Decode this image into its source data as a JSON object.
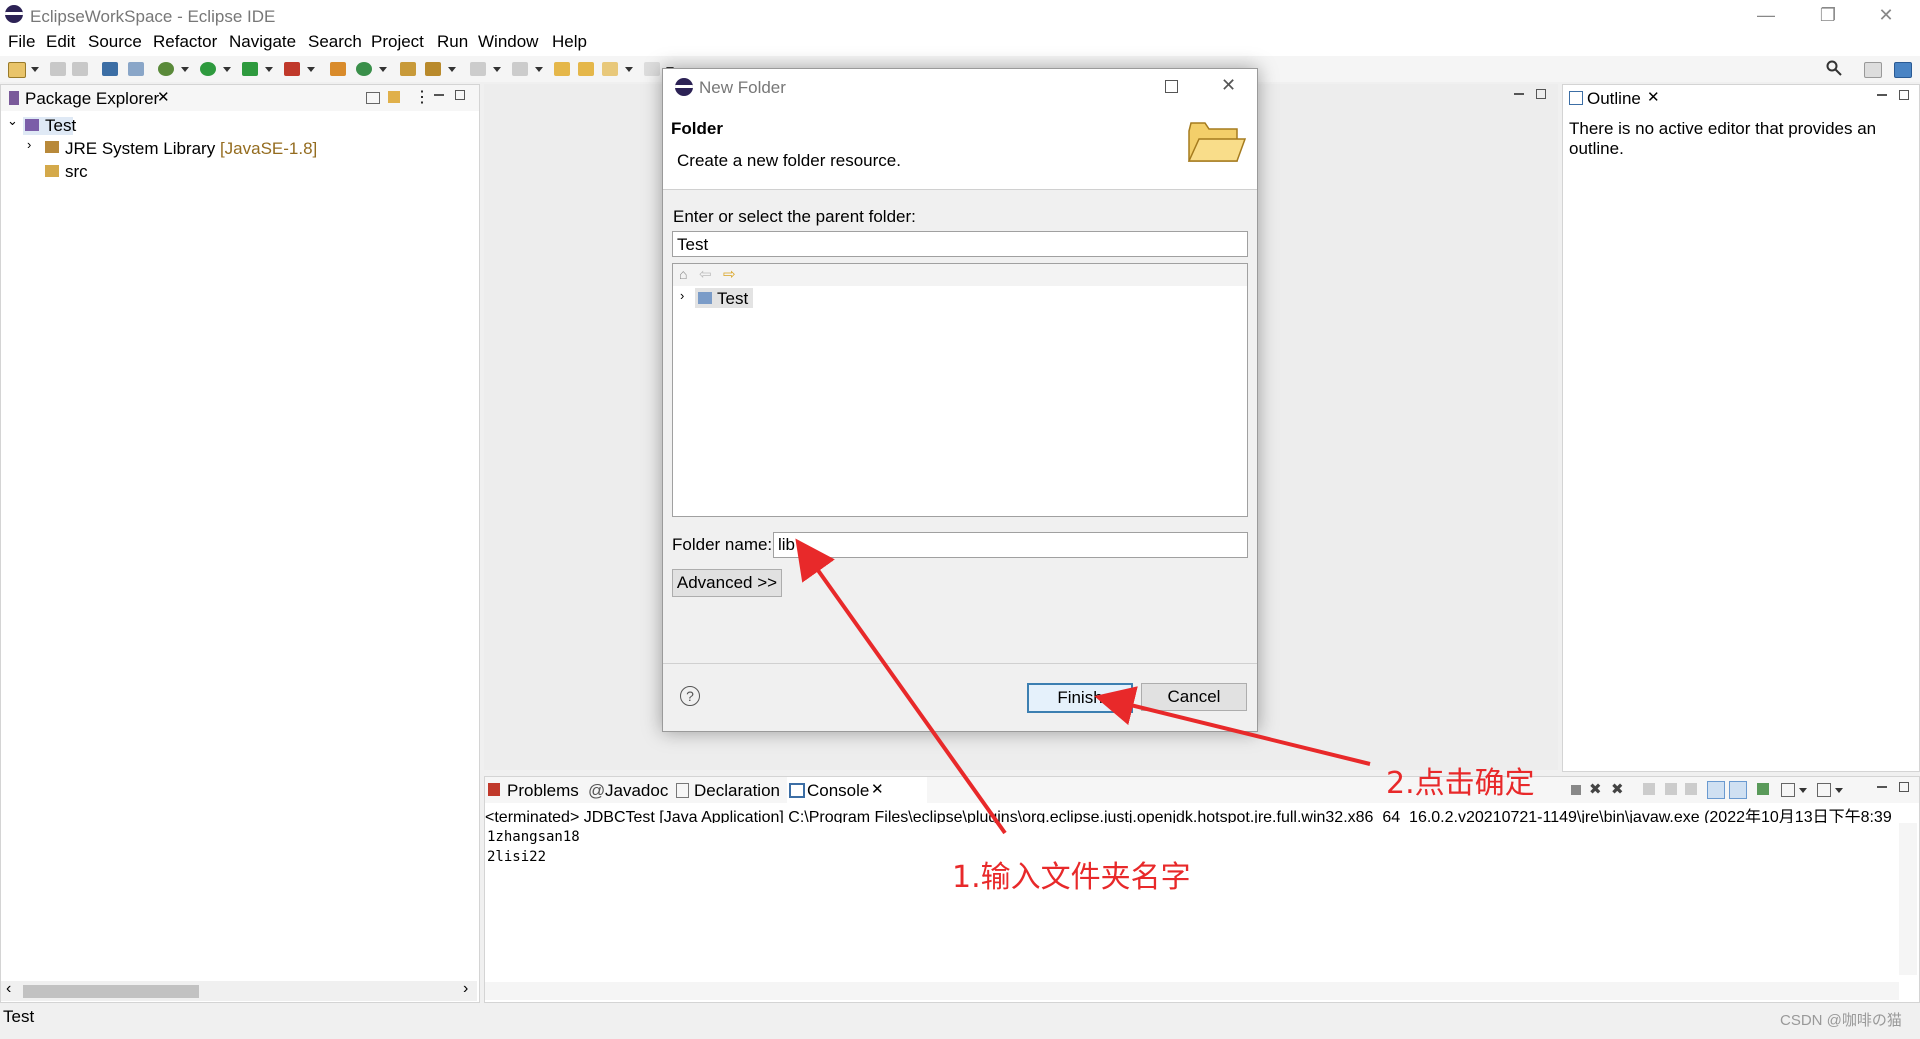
{
  "window": {
    "title": "EclipseWorkSpace - Eclipse IDE",
    "controls": {
      "minimize": "—",
      "restore": "❐",
      "close": "✕"
    }
  },
  "menu": [
    "File",
    "Edit",
    "Source",
    "Refactor",
    "Navigate",
    "Search",
    "Project",
    "Run",
    "Window",
    "Help"
  ],
  "package_explorer": {
    "tab": "Package Explorer",
    "tree": [
      {
        "label": "Test",
        "expanded": true
      },
      {
        "label": "JRE System Library",
        "suffix": "[JavaSE-1.8]"
      },
      {
        "label": "src"
      }
    ],
    "status": "Test"
  },
  "outline": {
    "tab": "Outline",
    "message": "There is no active editor that provides an outline."
  },
  "bottom": {
    "tabs": [
      "Problems",
      "Javadoc",
      "Declaration",
      "Console"
    ],
    "console": {
      "header": "<terminated> JDBCTest [Java Application] C:\\Program Files\\eclipse\\plugins\\org.eclipse.justj.openjdk.hotspot.jre.full.win32.x86_64_16.0.2.v20210721-1149\\jre\\bin\\javaw.exe  (2022年10月13日下午8:39",
      "lines": [
        "1zhangsan18",
        "2lisi22"
      ]
    }
  },
  "dialog": {
    "title": "New Folder",
    "heading": "Folder",
    "description": "Create a new folder resource.",
    "parent_label": "Enter or select the parent folder:",
    "parent_value": "Test",
    "tree_item": "Test",
    "folder_name_label": "Folder name:",
    "folder_name_value": "lib",
    "advanced": "Advanced >>",
    "finish": "Finish",
    "cancel": "Cancel",
    "help": "?"
  },
  "annotations": {
    "step1": "1.输入文件夹名字",
    "step2": "2.点击确定"
  },
  "watermark": "CSDN @咖啡の猫",
  "colors": {
    "annotation": "#e8292a",
    "accent": "#3c7fb1",
    "jre_suffix": "#946c1f"
  }
}
